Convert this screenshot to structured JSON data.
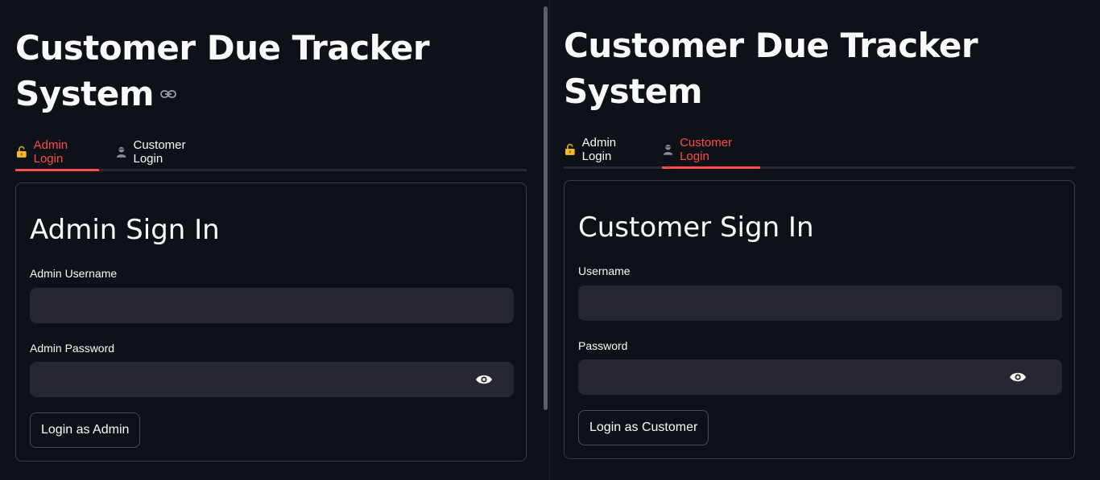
{
  "left_pane": {
    "title": "Customer Due Tracker System",
    "tabs": [
      {
        "label": "Admin Login",
        "icon": "unlocked-padlock-icon",
        "active": true
      },
      {
        "label": "Customer Login",
        "icon": "person-bust-icon",
        "active": false
      }
    ],
    "card": {
      "heading": "Admin Sign In",
      "username_label": "Admin Username",
      "username_value": "",
      "password_label": "Admin Password",
      "password_value": "",
      "submit_label": "Login as Admin"
    }
  },
  "right_pane": {
    "title": "Customer Due Tracker System",
    "tabs": [
      {
        "label": "Admin Login",
        "icon": "unlocked-padlock-icon",
        "active": false
      },
      {
        "label": "Customer Login",
        "icon": "person-bust-icon",
        "active": true
      }
    ],
    "card": {
      "heading": "Customer Sign In",
      "username_label": "Username",
      "username_value": "",
      "password_label": "Password",
      "password_value": "",
      "submit_label": "Login as Customer"
    }
  },
  "colors": {
    "background": "#0e1117",
    "accent": "#ff4b4b",
    "input_bg": "#262730",
    "border": "#3a3d45"
  }
}
